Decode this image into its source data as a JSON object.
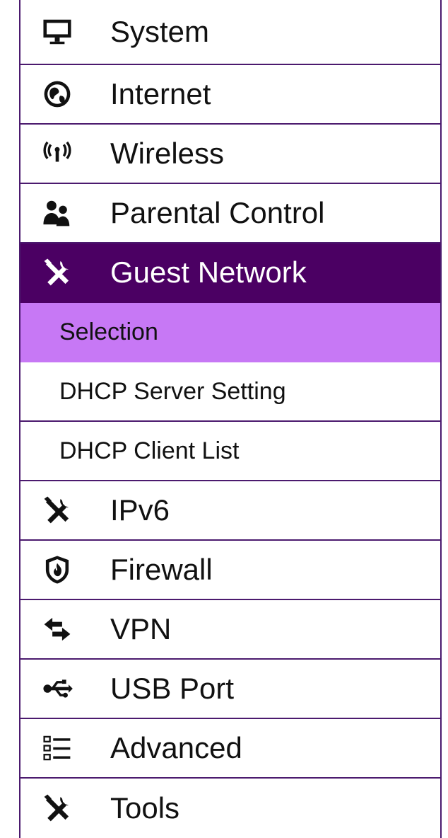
{
  "menu": {
    "items": [
      {
        "label": "System",
        "icon": "monitor-icon"
      },
      {
        "label": "Internet",
        "icon": "globe-icon"
      },
      {
        "label": "Wireless",
        "icon": "wireless-signal-icon"
      },
      {
        "label": "Parental Control",
        "icon": "users-icon"
      },
      {
        "label": "Guest Network",
        "icon": "wrench-screwdriver-icon",
        "active": true
      },
      {
        "label": "Selection",
        "submenu": true,
        "active": true
      },
      {
        "label": "DHCP Server Setting",
        "submenu": true
      },
      {
        "label": "DHCP Client List",
        "submenu": true
      },
      {
        "label": "IPv6",
        "icon": "wrench-screwdriver-icon"
      },
      {
        "label": "Firewall",
        "icon": "shield-fire-icon"
      },
      {
        "label": "VPN",
        "icon": "swap-arrows-icon"
      },
      {
        "label": "USB Port",
        "icon": "usb-icon"
      },
      {
        "label": "Advanced",
        "icon": "list-icon"
      },
      {
        "label": "Tools",
        "icon": "wrench-screwdriver-icon"
      }
    ]
  },
  "colors": {
    "border": "#4b1a6e",
    "active_main_bg": "#4b0063",
    "active_sub_bg": "#c778f5"
  }
}
